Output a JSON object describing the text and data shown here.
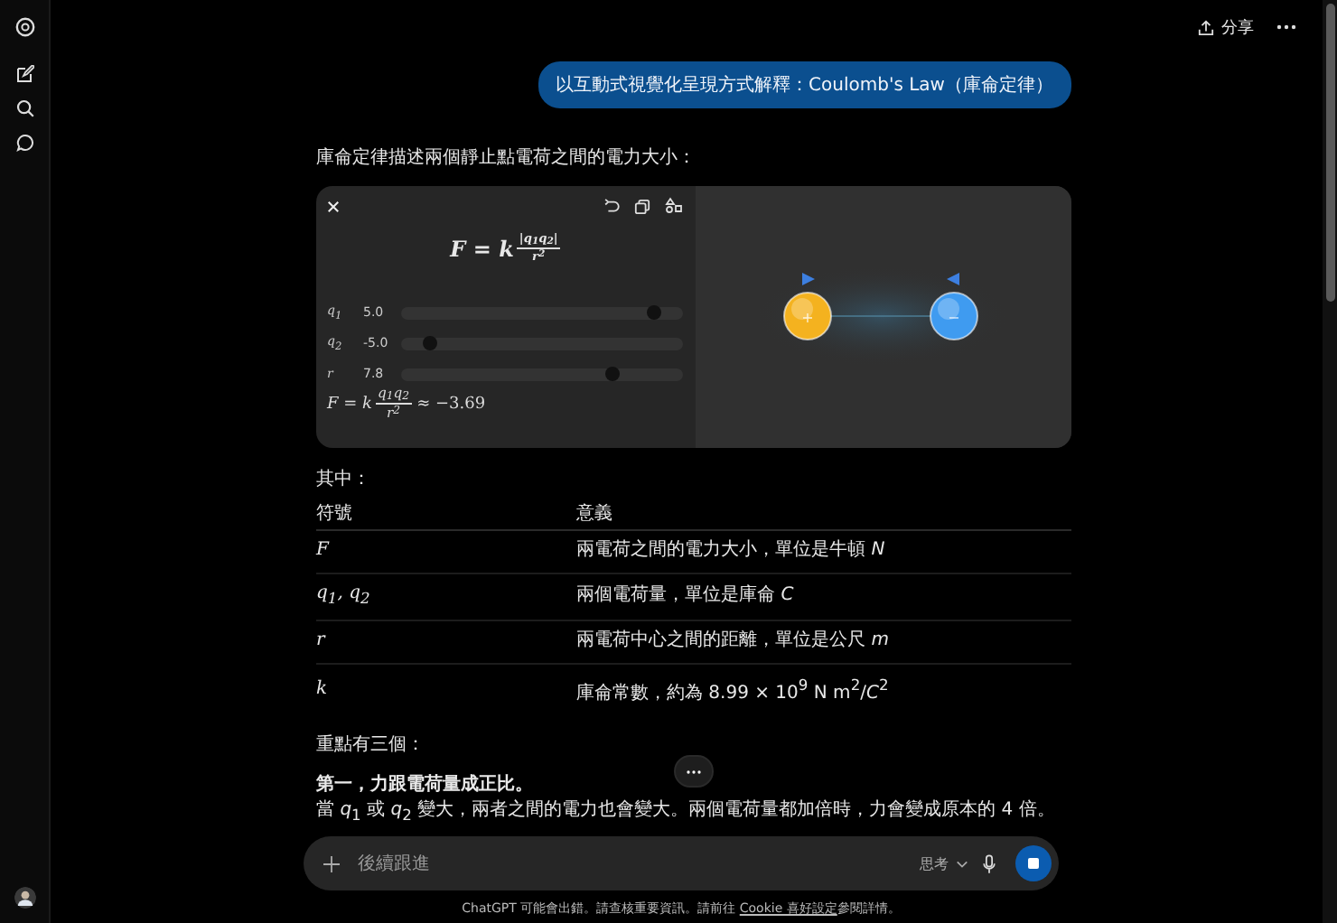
{
  "header": {
    "share_label": "分享"
  },
  "user_message": "以互動式視覺化呈現方式解釋：Coulomb's Law（庫侖定律）",
  "intro": "庫侖定律描述兩個靜止點電荷之間的電力大小：",
  "widget": {
    "formula": {
      "lhs": "F = k",
      "numerator": "|q$_{1}$q$_{2}$|",
      "denominator": "r$^{2}$"
    },
    "sliders": [
      {
        "label": "q$_{1}$",
        "reading": "5.0",
        "level": 0.9
      },
      {
        "label": "q$_{2}$",
        "reading": "-5.0",
        "level": 0.1
      },
      {
        "label": "r",
        "reading": "7.8",
        "level": 0.75
      }
    ],
    "result": {
      "lhs": "F = k",
      "numerator": "q$_{1}$q$_{2}$",
      "denominator": "r$^{2}$",
      "value": "≈ −3.69"
    },
    "attract": true,
    "charges": [
      {
        "sign": "+",
        "color": "#f4b21f"
      },
      {
        "sign": "−",
        "color": "#3f9bf0"
      }
    ]
  },
  "where_label": "其中：",
  "table": {
    "columns": [
      "符號",
      "意義"
    ],
    "rows": [
      {
        "symbol": "F",
        "meaning": "兩電荷之間的電力大小，單位是牛頓 *N*"
      },
      {
        "symbol": "q$_{1}$, q$_{2}$",
        "meaning": "兩個電荷量，單位是庫侖 *C*"
      },
      {
        "symbol": "r",
        "meaning": "兩電荷中心之間的距離，單位是公尺 *m*"
      },
      {
        "symbol": "k",
        "meaning": "庫侖常數，約為 8.99 × 10$^{9}$ N m$^{2}$/*C*$^{2}$"
      }
    ]
  },
  "key_points_heading": "重點有三個：",
  "point_title": "第一，力跟電荷量成正比。",
  "point_body": "當 *q*$_{1}$ 或 *q*$_{2}$ 變大，兩者之間的電力也會變大。兩個電荷量都加倍時，力會變成原本的 4 倍。",
  "composer": {
    "placeholder": "後續跟進",
    "mode": "思考"
  },
  "footer": {
    "before": "ChatGPT 可能會出錯。請查核重要資訊。請前往 ",
    "link": "Cookie 喜好設定",
    "after": "參閱詳情。"
  }
}
